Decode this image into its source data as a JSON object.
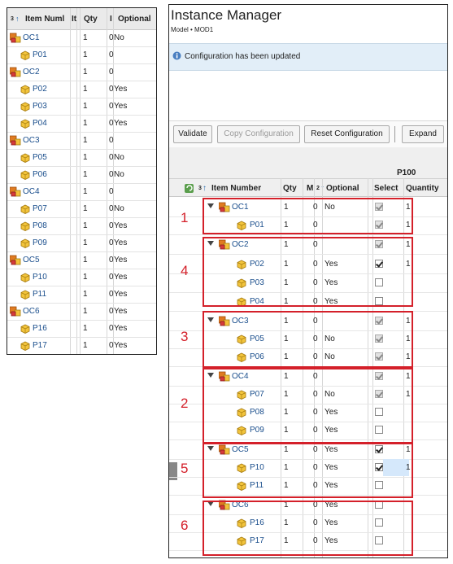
{
  "left_panel": {
    "headers": {
      "sort": "3",
      "item": "Item Numl",
      "it": "It",
      "qty": "Qty",
      "im": "I",
      "optional": "Optional"
    },
    "rows": [
      {
        "name": "OC1",
        "type": "oc",
        "qty": "1",
        "im": "0",
        "optional": "No"
      },
      {
        "name": "P01",
        "type": "p",
        "qty": "1",
        "im": "0",
        "optional": ""
      },
      {
        "name": "OC2",
        "type": "oc",
        "qty": "1",
        "im": "0",
        "optional": ""
      },
      {
        "name": "P02",
        "type": "p",
        "qty": "1",
        "im": "0",
        "optional": "Yes"
      },
      {
        "name": "P03",
        "type": "p",
        "qty": "1",
        "im": "0",
        "optional": "Yes"
      },
      {
        "name": "P04",
        "type": "p",
        "qty": "1",
        "im": "0",
        "optional": "Yes"
      },
      {
        "name": "OC3",
        "type": "oc",
        "qty": "1",
        "im": "0",
        "optional": ""
      },
      {
        "name": "P05",
        "type": "p",
        "qty": "1",
        "im": "0",
        "optional": "No"
      },
      {
        "name": "P06",
        "type": "p",
        "qty": "1",
        "im": "0",
        "optional": "No"
      },
      {
        "name": "OC4",
        "type": "oc",
        "qty": "1",
        "im": "0",
        "optional": ""
      },
      {
        "name": "P07",
        "type": "p",
        "qty": "1",
        "im": "0",
        "optional": "No"
      },
      {
        "name": "P08",
        "type": "p",
        "qty": "1",
        "im": "0",
        "optional": "Yes"
      },
      {
        "name": "P09",
        "type": "p",
        "qty": "1",
        "im": "0",
        "optional": "Yes"
      },
      {
        "name": "OC5",
        "type": "oc",
        "qty": "1",
        "im": "0",
        "optional": "Yes"
      },
      {
        "name": "P10",
        "type": "p",
        "qty": "1",
        "im": "0",
        "optional": "Yes"
      },
      {
        "name": "P11",
        "type": "p",
        "qty": "1",
        "im": "0",
        "optional": "Yes"
      },
      {
        "name": "OC6",
        "type": "oc",
        "qty": "1",
        "im": "0",
        "optional": "Yes"
      },
      {
        "name": "P16",
        "type": "p",
        "qty": "1",
        "im": "0",
        "optional": "Yes"
      },
      {
        "name": "P17",
        "type": "p",
        "qty": "1",
        "im": "0",
        "optional": "Yes"
      }
    ]
  },
  "window": {
    "title": "Instance Manager",
    "subtitle": "Model • MOD1",
    "message": "Configuration has been updated"
  },
  "toolbar": {
    "validate": "Validate",
    "copy_configuration": "Copy Configuration",
    "reset_configuration": "Reset Configuration",
    "expand": "Expand"
  },
  "grid": {
    "group_header": "P100",
    "headers": {
      "sort": "3",
      "item": "Item Number",
      "qty": "Qty",
      "im": "M",
      "opt_sort": "2",
      "optional": "Optional",
      "select": "Select",
      "quantity": "Quantity"
    },
    "rows": [
      {
        "name": "OC1",
        "type": "oc",
        "qty": "1",
        "im": "0",
        "optional": "No",
        "select": "on-dis",
        "quantity": "1"
      },
      {
        "name": "P01",
        "type": "p",
        "qty": "1",
        "im": "0",
        "optional": "",
        "select": "on-dis",
        "quantity": "1"
      },
      {
        "name": "OC2",
        "type": "oc",
        "qty": "1",
        "im": "0",
        "optional": "",
        "select": "on-dis",
        "quantity": "1"
      },
      {
        "name": "P02",
        "type": "p",
        "qty": "1",
        "im": "0",
        "optional": "Yes",
        "select": "on",
        "quantity": "1"
      },
      {
        "name": "P03",
        "type": "p",
        "qty": "1",
        "im": "0",
        "optional": "Yes",
        "select": "off",
        "quantity": ""
      },
      {
        "name": "P04",
        "type": "p",
        "qty": "1",
        "im": "0",
        "optional": "Yes",
        "select": "off",
        "quantity": ""
      },
      {
        "name": "OC3",
        "type": "oc",
        "qty": "1",
        "im": "0",
        "optional": "",
        "select": "on-dis",
        "quantity": "1"
      },
      {
        "name": "P05",
        "type": "p",
        "qty": "1",
        "im": "0",
        "optional": "No",
        "select": "on-dis",
        "quantity": "1"
      },
      {
        "name": "P06",
        "type": "p",
        "qty": "1",
        "im": "0",
        "optional": "No",
        "select": "on-dis",
        "quantity": "1"
      },
      {
        "name": "OC4",
        "type": "oc",
        "qty": "1",
        "im": "0",
        "optional": "",
        "select": "on-dis",
        "quantity": "1"
      },
      {
        "name": "P07",
        "type": "p",
        "qty": "1",
        "im": "0",
        "optional": "No",
        "select": "on-dis",
        "quantity": "1"
      },
      {
        "name": "P08",
        "type": "p",
        "qty": "1",
        "im": "0",
        "optional": "Yes",
        "select": "off",
        "quantity": ""
      },
      {
        "name": "P09",
        "type": "p",
        "qty": "1",
        "im": "0",
        "optional": "Yes",
        "select": "off",
        "quantity": ""
      },
      {
        "name": "OC5",
        "type": "oc",
        "qty": "1",
        "im": "0",
        "optional": "Yes",
        "select": "on",
        "quantity": "1"
      },
      {
        "name": "P10",
        "type": "p",
        "qty": "1",
        "im": "0",
        "optional": "Yes",
        "select": "on",
        "quantity": "1"
      },
      {
        "name": "P11",
        "type": "p",
        "qty": "1",
        "im": "0",
        "optional": "Yes",
        "select": "off",
        "quantity": ""
      },
      {
        "name": "OC6",
        "type": "oc",
        "qty": "1",
        "im": "0",
        "optional": "Yes",
        "select": "off",
        "quantity": ""
      },
      {
        "name": "P16",
        "type": "p",
        "qty": "1",
        "im": "0",
        "optional": "Yes",
        "select": "off",
        "quantity": ""
      },
      {
        "name": "P17",
        "type": "p",
        "qty": "1",
        "im": "0",
        "optional": "Yes",
        "select": "off",
        "quantity": ""
      }
    ],
    "group_labels": [
      "1",
      "4",
      "3",
      "2",
      "5",
      "6"
    ]
  },
  "colors": {
    "annotation_red": "#d4202a",
    "link_blue": "#1a4e8c",
    "message_bg": "#e2eef8"
  },
  "icons": {
    "option_class": "option-class-icon",
    "part": "part-icon",
    "info": "info-icon",
    "refresh": "refresh-icon",
    "expand": "expand-arrow-icon"
  }
}
